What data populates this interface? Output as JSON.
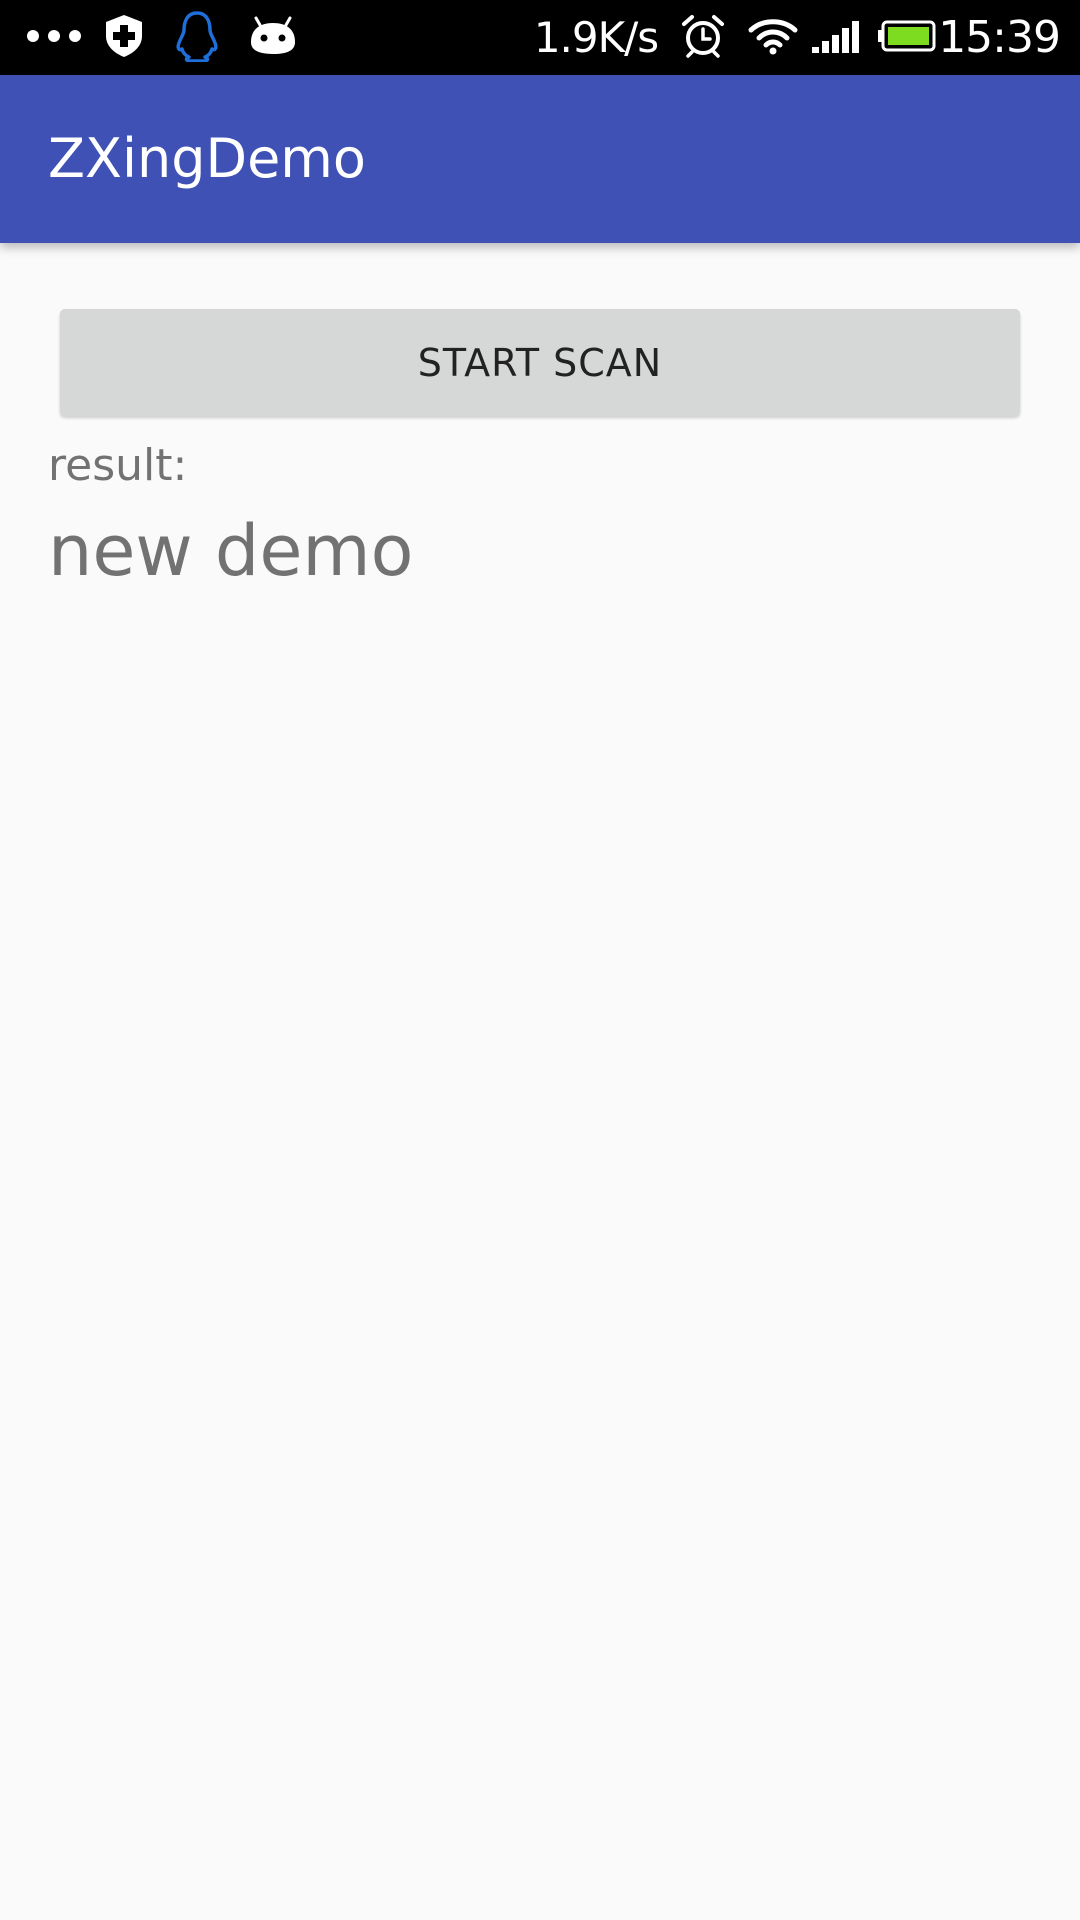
{
  "status_bar": {
    "left_icons": [
      "more-dots-icon",
      "shield-plus-icon",
      "qq-penguin-icon",
      "android-bot-icon"
    ],
    "network_speed": "1.9K/s",
    "right_icons": [
      "alarm-icon",
      "wifi-icon",
      "signal-icon",
      "battery-icon"
    ],
    "time": "15:39"
  },
  "app_bar": {
    "title": "ZXingDemo",
    "color": "#3f51b5"
  },
  "main": {
    "scan_button_label": "START SCAN",
    "result_label": "result:",
    "result_value": "new demo"
  },
  "colors": {
    "background": "#fafafa",
    "button": "#d6d7d7",
    "secondary_text": "#727272",
    "battery_fill": "#7ddc1f",
    "qq_icon": "#1e6fd9"
  }
}
